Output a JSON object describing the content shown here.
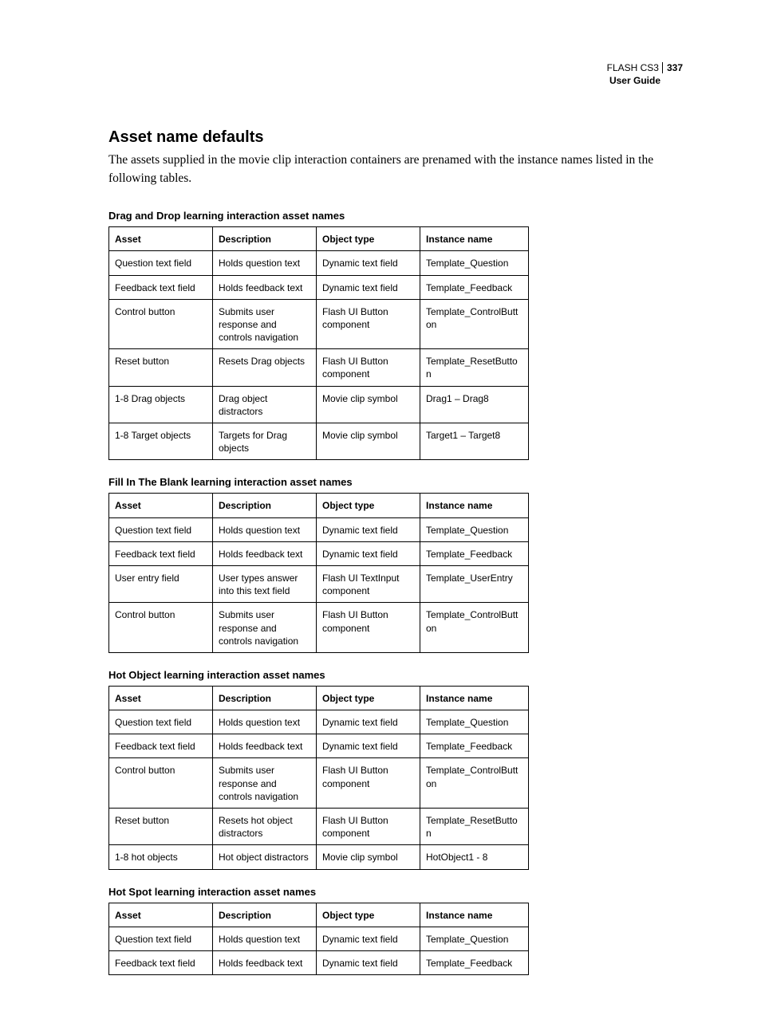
{
  "header": {
    "product": "FLASH CS3",
    "page_number": "337",
    "guide": "User Guide"
  },
  "section": {
    "title": "Asset name defaults",
    "intro": "The assets supplied in the movie clip interaction containers are prenamed with the instance names listed in the following tables."
  },
  "tables": [
    {
      "title": "Drag and Drop learning interaction asset names",
      "headers": [
        "Asset",
        "Description",
        "Object type",
        "Instance name"
      ],
      "rows": [
        [
          "Question text field",
          "Holds question text",
          "Dynamic text field",
          "Template_Question"
        ],
        [
          "Feedback text field",
          "Holds feedback text",
          "Dynamic text field",
          "Template_Feedback"
        ],
        [
          "Control button",
          "Submits user response and controls navigation",
          "Flash UI Button component",
          "Template_ControlButton"
        ],
        [
          "Reset button",
          "Resets Drag objects",
          "Flash UI Button component",
          "Template_ResetButton"
        ],
        [
          "1-8 Drag objects",
          "Drag object distractors",
          "Movie clip symbol",
          "Drag1 – Drag8"
        ],
        [
          "1-8 Target objects",
          "Targets for Drag objects",
          "Movie clip symbol",
          "Target1 – Target8"
        ]
      ]
    },
    {
      "title": "Fill In The Blank learning interaction asset names",
      "headers": [
        "Asset",
        "Description",
        "Object type",
        "Instance name"
      ],
      "rows": [
        [
          "Question text field",
          "Holds question text",
          "Dynamic text field",
          "Template_Question"
        ],
        [
          "Feedback text field",
          "Holds feedback text",
          "Dynamic text field",
          "Template_Feedback"
        ],
        [
          "User entry field",
          "User types answer into this text field",
          "Flash UI TextInput component",
          "Template_UserEntry"
        ],
        [
          "Control button",
          "Submits user response and controls navigation",
          "Flash UI Button component",
          "Template_ControlButton"
        ]
      ]
    },
    {
      "title": "Hot Object learning interaction asset names",
      "headers": [
        "Asset",
        "Description",
        "Object type",
        "Instance name"
      ],
      "rows": [
        [
          "Question text field",
          "Holds question text",
          "Dynamic text field",
          "Template_Question"
        ],
        [
          "Feedback text field",
          "Holds feedback text",
          "Dynamic text field",
          "Template_Feedback"
        ],
        [
          "Control button",
          "Submits user response and controls navigation",
          "Flash UI Button component",
          "Template_ControlButton"
        ],
        [
          "Reset button",
          "Resets hot object distractors",
          "Flash UI Button component",
          "Template_ResetButton"
        ],
        [
          "1-8 hot objects",
          "Hot object distractors",
          "Movie clip symbol",
          "HotObject1 - 8"
        ]
      ]
    },
    {
      "title": "Hot Spot learning interaction asset names",
      "headers": [
        "Asset",
        "Description",
        "Object type",
        "Instance name"
      ],
      "rows": [
        [
          "Question text field",
          "Holds question text",
          "Dynamic text field",
          "Template_Question"
        ],
        [
          "Feedback text field",
          "Holds feedback text",
          "Dynamic text field",
          "Template_Feedback"
        ]
      ]
    }
  ]
}
